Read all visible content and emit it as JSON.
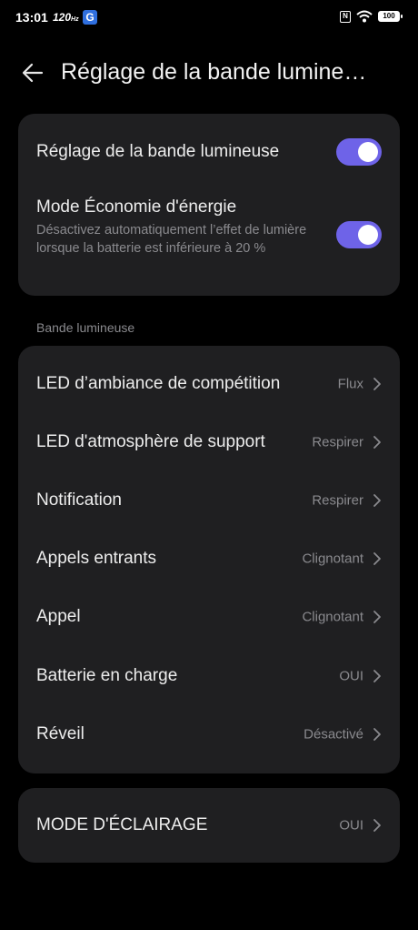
{
  "status": {
    "time": "13:01",
    "refresh": "120",
    "refresh_unit": "Hz",
    "g_label": "G",
    "nfc_label": "N",
    "battery": "100"
  },
  "header": {
    "title": "Réglage de la bande lumine…"
  },
  "toggles": [
    {
      "title": "Réglage de la bande lumineuse",
      "subtitle": "",
      "on": true
    },
    {
      "title": "Mode Économie d'énergie",
      "subtitle": "Désactivez automatiquement l’effet de lumière lorsque la batterie est inférieure à 20 %",
      "on": true
    }
  ],
  "section_label": "Bande lumineuse",
  "list": [
    {
      "label": "LED d’ambiance de compétition",
      "value": "Flux"
    },
    {
      "label": "LED d'atmosphère de support",
      "value": "Respirer"
    },
    {
      "label": "Notification",
      "value": "Respirer"
    },
    {
      "label": "Appels entrants",
      "value": "Clignotant"
    },
    {
      "label": "Appel",
      "value": "Clignotant"
    },
    {
      "label": "Batterie en charge",
      "value": "OUI"
    },
    {
      "label": "Réveil",
      "value": "Désactivé"
    }
  ],
  "mode": {
    "label": "MODE D'ÉCLAIRAGE",
    "value": "OUI"
  },
  "colors": {
    "accent": "#6e63e8",
    "card": "#1f1f21",
    "background": "#000000"
  }
}
